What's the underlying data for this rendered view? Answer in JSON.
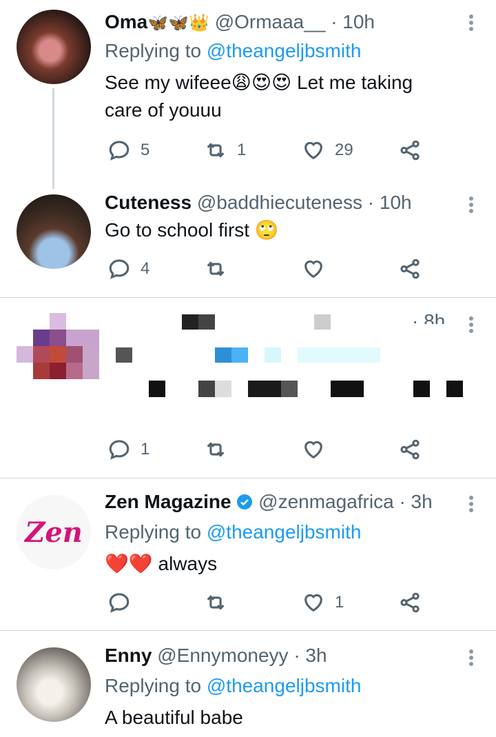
{
  "colors": {
    "link": "#1d9bf0",
    "muted": "#536471",
    "divider": "#cfd9de",
    "heart_red": "#e0245e",
    "verified": "#1d9bf0"
  },
  "tweets": [
    {
      "name": "Oma",
      "name_emojis": "🦋🦋👑",
      "handle": "@Ormaaa__",
      "time": "· 10h",
      "replying_prefix": "Replying to",
      "replying_handle": "@theangeljbsmith",
      "text_line1": "See my wifeee",
      "text_emojis": "😩😍😍",
      "text_after": " Let me taking",
      "text_line2": "care of youuu",
      "replies": "5",
      "retweets": "1",
      "likes": "29"
    },
    {
      "name": "Cuteness",
      "handle": "@baddhiecuteness",
      "time": "· 10h",
      "text": "Go to school first",
      "text_emoji": "🙄",
      "replies": "4",
      "retweets": "",
      "likes": ""
    },
    {
      "time": "· 8h",
      "replies": "1",
      "retweets": "",
      "likes": ""
    },
    {
      "name": "Zen Magazine",
      "handle": "@zenmagafrica",
      "time": "· 3h",
      "replying_prefix": "Replying to",
      "replying_handle": "@theangeljbsmith",
      "text_emojis": "❤️❤️",
      "text": "always",
      "avatar_text": "Zen",
      "replies": "",
      "retweets": "",
      "likes": "1"
    },
    {
      "name": "Enny",
      "handle": "@Ennymoneyy",
      "time": "· 3h",
      "replying_prefix": "Replying to",
      "replying_handle": "@theangeljbsmith",
      "text": "A beautiful babe"
    }
  ]
}
